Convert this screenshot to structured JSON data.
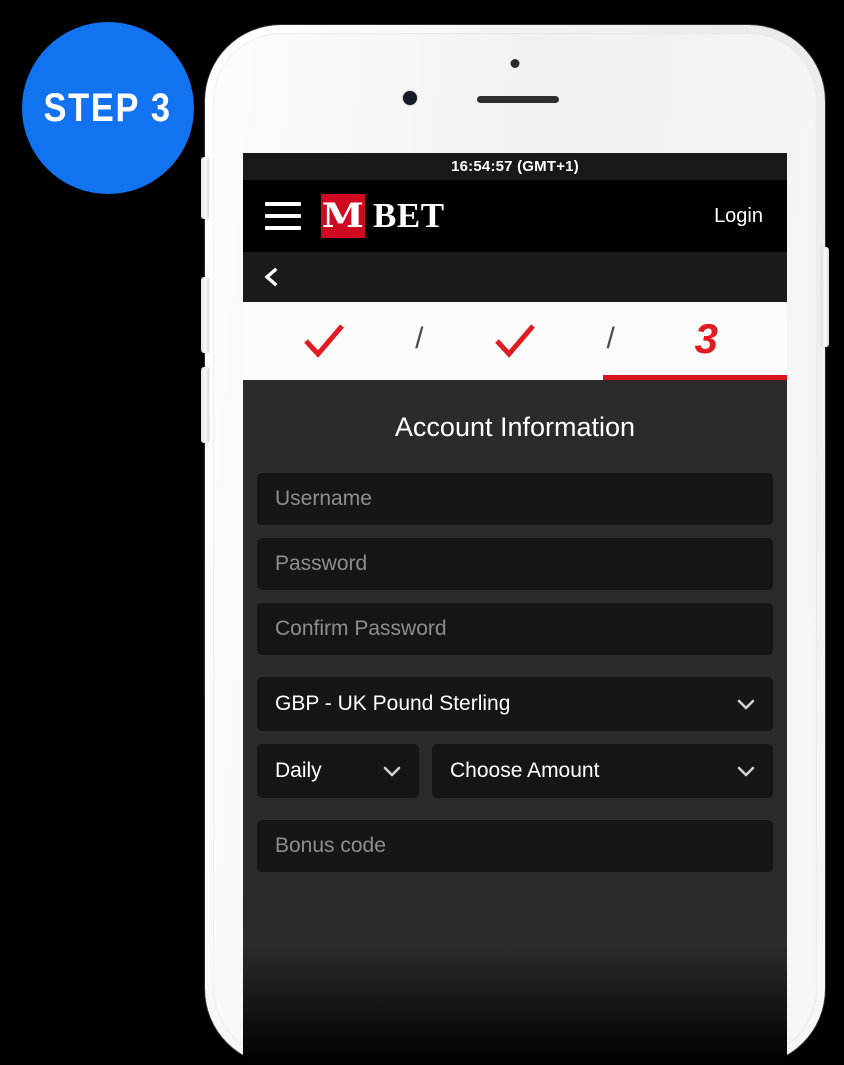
{
  "badge": {
    "label": "STEP 3",
    "color": "#1273f0"
  },
  "phone": {
    "hardware": {
      "camera": "camera-dot",
      "speaker": "speaker-grille",
      "sensor": "proximity-sensor-dot"
    }
  },
  "statusbar": {
    "time": "16:54:57 (GMT+1)"
  },
  "header": {
    "menu_icon": "hamburger-menu-icon",
    "brand_mark_letter": "M",
    "brand_word": "BET",
    "brand_color": "#cf0a20",
    "login_label": "Login"
  },
  "navbar": {
    "back_icon": "chevron-left-icon"
  },
  "steps": {
    "items": [
      {
        "type": "check",
        "icon": "checkmark-icon",
        "label": "",
        "state": "completed"
      },
      {
        "type": "separator",
        "label": "/"
      },
      {
        "type": "check",
        "icon": "checkmark-icon",
        "label": "",
        "state": "completed"
      },
      {
        "type": "separator",
        "label": "/"
      },
      {
        "type": "number",
        "label": "3",
        "state": "active"
      }
    ],
    "accent_color": "#d8141d"
  },
  "form": {
    "title": "Account Information",
    "fields": [
      {
        "name": "username",
        "placeholder": "Username",
        "value": ""
      },
      {
        "name": "password",
        "placeholder": "Password",
        "value": ""
      },
      {
        "name": "confirm-password",
        "placeholder": "Confirm Password",
        "value": ""
      }
    ],
    "currency_select": {
      "value": "GBP - UK Pound Sterling",
      "chevron": "chevron-down-icon"
    },
    "limit_period_select": {
      "value": "Daily",
      "chevron": "chevron-down-icon"
    },
    "limit_amount_select": {
      "value": "Choose Amount",
      "chevron": "chevron-down-icon"
    },
    "bonus_field": {
      "placeholder": "Bonus code",
      "value": ""
    }
  }
}
